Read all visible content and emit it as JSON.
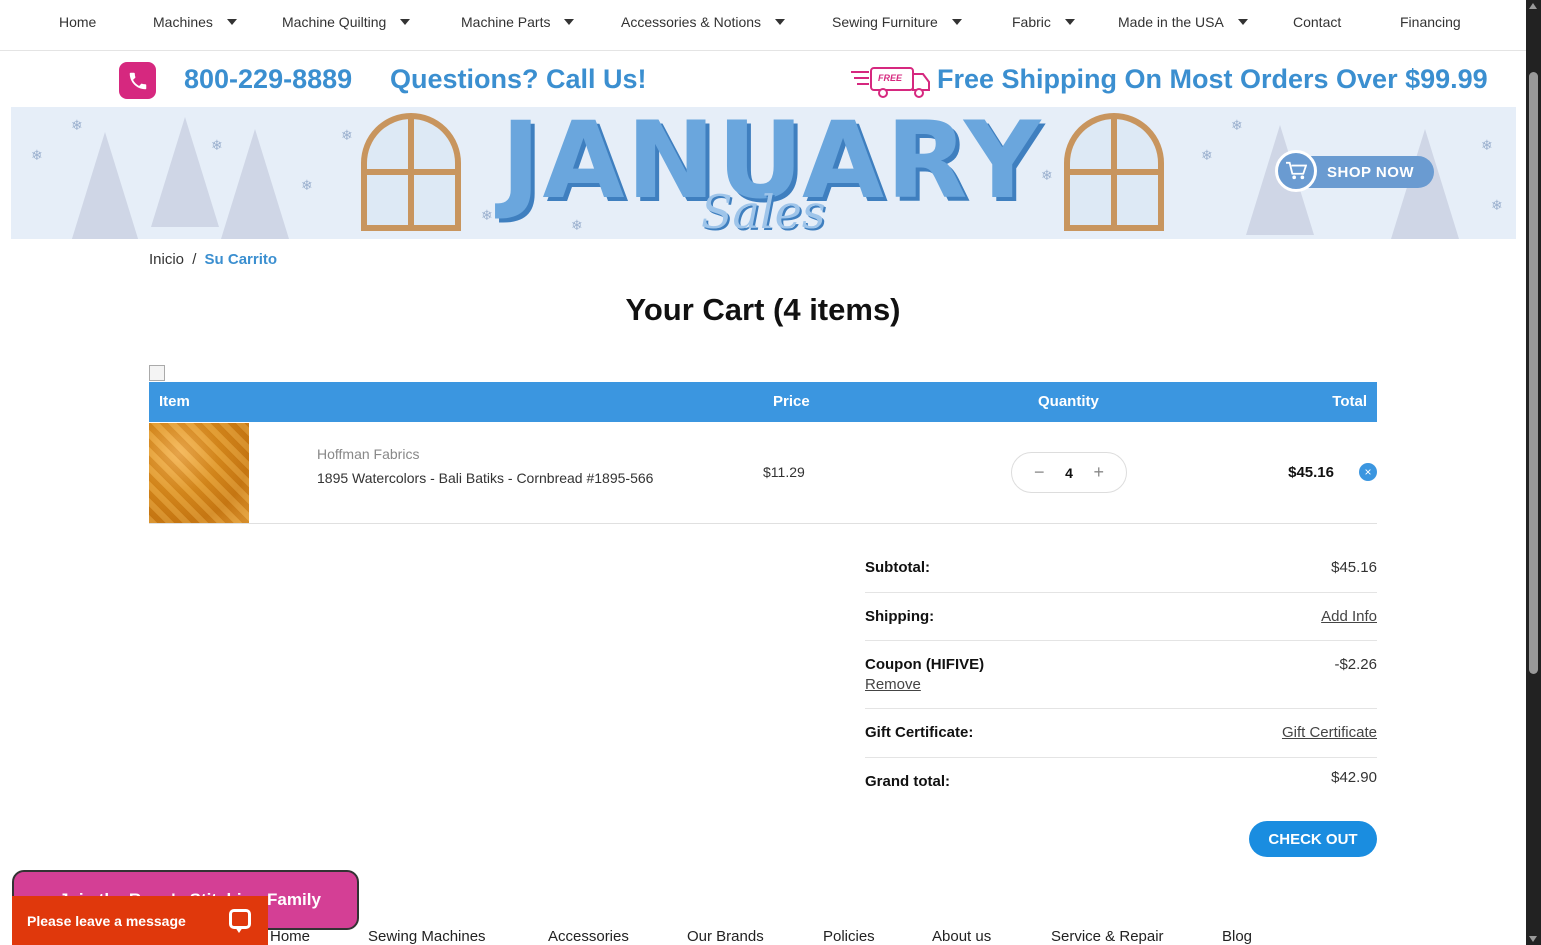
{
  "topnav": {
    "items": [
      {
        "label": "Home",
        "dropdown": false
      },
      {
        "label": "Machines",
        "dropdown": true
      },
      {
        "label": "Machine Quilting",
        "dropdown": true
      },
      {
        "label": "Machine Parts",
        "dropdown": true
      },
      {
        "label": "Accessories & Notions",
        "dropdown": true
      },
      {
        "label": "Sewing Furniture",
        "dropdown": true
      },
      {
        "label": "Fabric",
        "dropdown": true
      },
      {
        "label": "Made in the USA",
        "dropdown": true
      },
      {
        "label": "Contact",
        "dropdown": false
      },
      {
        "label": "Financing",
        "dropdown": false
      }
    ]
  },
  "promo": {
    "phone": "800-229-8889",
    "call_text": "Questions? Call Us!",
    "shipping_badge": "FREE",
    "shipping_text": "Free Shipping On Most Orders Over $99.99"
  },
  "banner": {
    "title": "JANUARY",
    "subtitle": "Sales",
    "cta": "SHOP NOW"
  },
  "breadcrumb": {
    "home": "Inicio",
    "separator": "/",
    "current": "Su Carrito"
  },
  "cart": {
    "title": "Your Cart (4 items)",
    "columns": {
      "item": "Item",
      "price": "Price",
      "quantity": "Quantity",
      "total": "Total"
    },
    "items": [
      {
        "brand": "Hoffman Fabrics",
        "name": "1895 Watercolors - Bali Batiks - Cornbread #1895-566",
        "price": "$11.29",
        "quantity": "4",
        "total": "$45.16",
        "minus": "−",
        "plus": "+",
        "remove": "×"
      }
    ]
  },
  "totals": {
    "subtotal_label": "Subtotal:",
    "subtotal_value": "$45.16",
    "shipping_label": "Shipping:",
    "shipping_link": "Add Info",
    "coupon_label": "Coupon (HIFIVE)",
    "coupon_value": "-$2.26",
    "coupon_remove": "Remove",
    "gift_label": "Gift Certificate:",
    "gift_link": "Gift Certificate",
    "grand_label": "Grand total:",
    "grand_value": "$42.90"
  },
  "checkout_label": "CHECK OUT",
  "footer_nav": [
    "Home",
    "Sewing Machines",
    "Accessories",
    "Our Brands",
    "Policies",
    "About us",
    "Service & Repair",
    "Blog"
  ],
  "widgets": {
    "family": "Join the Reno's Stitching Family",
    "chat": "Please leave a message"
  },
  "colors": {
    "accent": "#3b96e0",
    "brand_pink": "#d6287f",
    "promo_blue": "#3b8fd0",
    "chat_orange": "#e0380c"
  }
}
